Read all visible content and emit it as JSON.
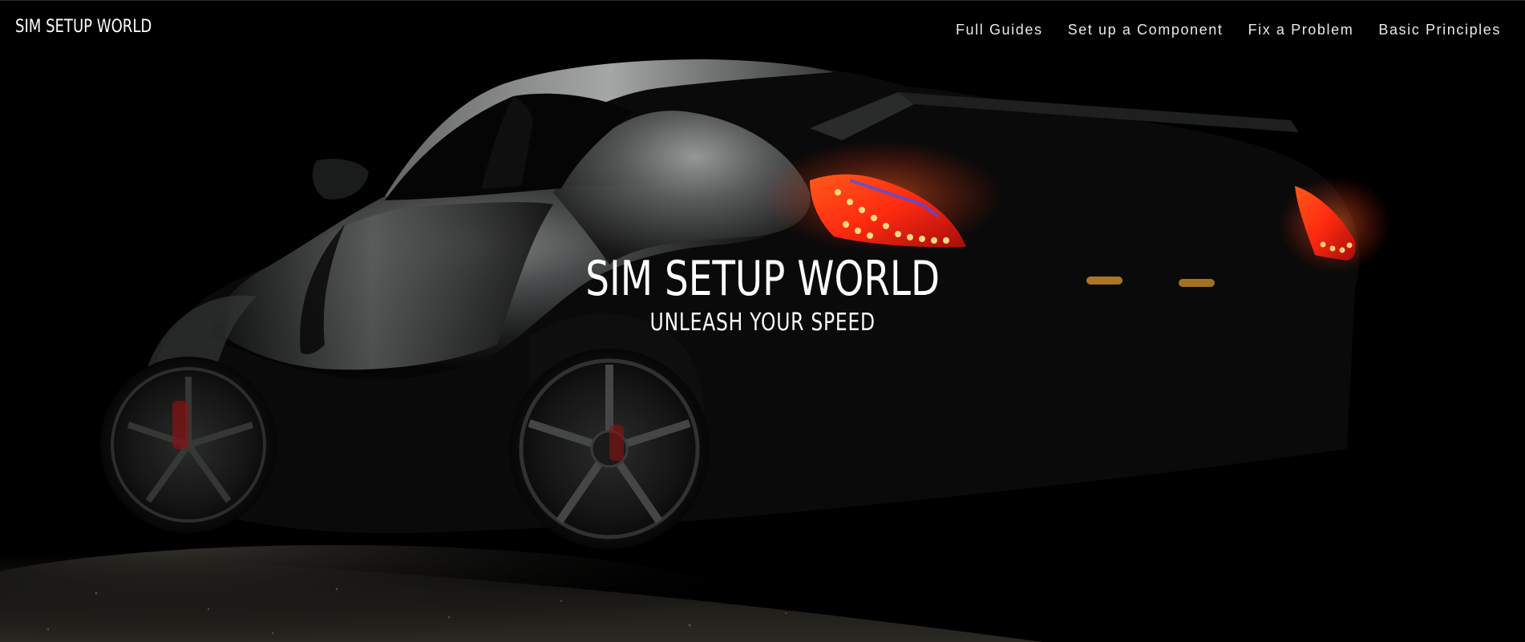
{
  "header": {
    "brand": "SIM SETUP WORLD",
    "nav": [
      {
        "label": "Full Guides"
      },
      {
        "label": "Set up a Component"
      },
      {
        "label": "Fix a Problem"
      },
      {
        "label": "Basic Principles"
      }
    ]
  },
  "hero": {
    "title": "SIM SETUP WORLD",
    "subtitle": "UNLEASH YOUR SPEED",
    "image": "dark sports car rear three-quarter view with lit red tail lights"
  },
  "colors": {
    "background": "#000000",
    "text": "#ffffff",
    "nav_text": "#e9e9e9",
    "taillight": "#ff3b1a"
  }
}
